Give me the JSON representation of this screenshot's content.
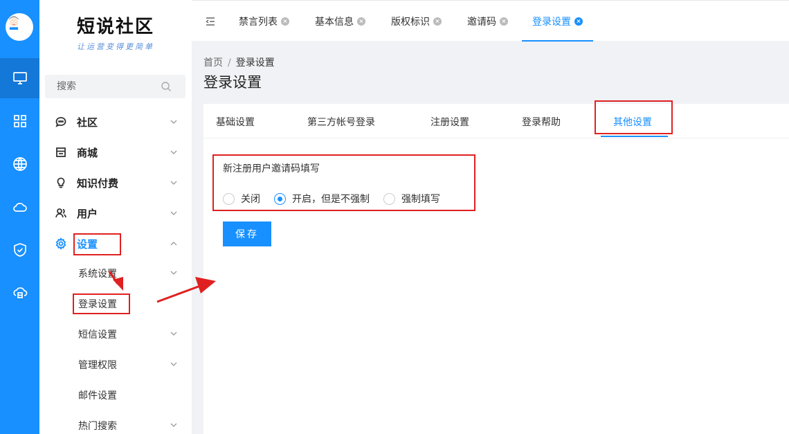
{
  "sidebar": {
    "logo_title": "短说社区",
    "logo_subtitle": "让运营变得更简单",
    "search_placeholder": "搜索",
    "menu": [
      {
        "label": "社区"
      },
      {
        "label": "商城"
      },
      {
        "label": "知识付费"
      },
      {
        "label": "用户"
      },
      {
        "label": "设置"
      }
    ],
    "submenu": [
      {
        "label": "系统设置"
      },
      {
        "label": "登录设置"
      },
      {
        "label": "短信设置"
      },
      {
        "label": "管理权限"
      },
      {
        "label": "邮件设置"
      },
      {
        "label": "热门搜索"
      }
    ]
  },
  "topbar": {
    "tabs": [
      {
        "label": "禁言列表"
      },
      {
        "label": "基本信息"
      },
      {
        "label": "版权标识"
      },
      {
        "label": "邀请码"
      },
      {
        "label": "登录设置"
      }
    ]
  },
  "page": {
    "breadcrumb_home": "首页",
    "breadcrumb_sep": "/",
    "breadcrumb_current": "登录设置",
    "title": "登录设置"
  },
  "card": {
    "tabs": [
      {
        "label": "基础设置"
      },
      {
        "label": "第三方帐号登录"
      },
      {
        "label": "注册设置"
      },
      {
        "label": "登录帮助"
      },
      {
        "label": "其他设置"
      }
    ],
    "field_label": "新注册用户邀请码填写",
    "options": [
      {
        "label": "关闭"
      },
      {
        "label": "开启，但是不强制"
      },
      {
        "label": "强制填写"
      }
    ],
    "selected_option": "开启，但是不强制",
    "save_label": "保存"
  },
  "colors": {
    "accent": "#1890ff",
    "annotation": "#e02020"
  }
}
